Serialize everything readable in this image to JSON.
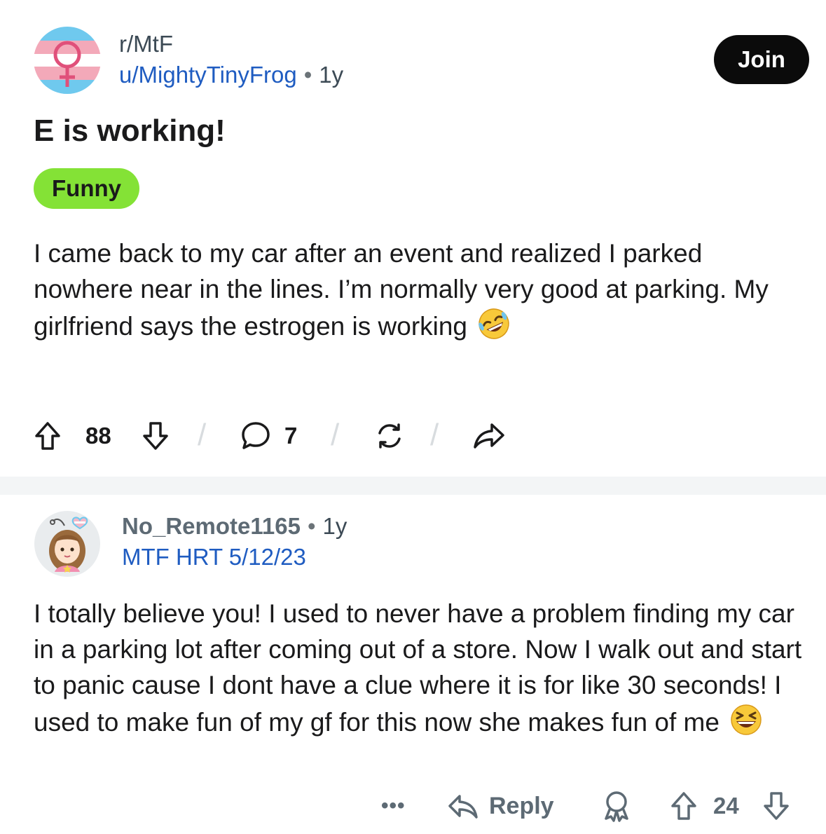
{
  "post": {
    "subreddit": "r/MtF",
    "username": "u/MightyTinyFrog",
    "separator": "•",
    "age": "1y",
    "join_label": "Join",
    "title": "E is working!",
    "flair": "Funny",
    "flair_color": "#84e236",
    "body": "I came back to my car after an event and realized I parked nowhere near in the lines. I’m normally very good at parking. My girlfriend says the estrogen is working",
    "body_emoji": "rolling-on-floor-laughing-emoji",
    "upvotes": "88",
    "comments": "7"
  },
  "comment": {
    "username": "No_Remote1165",
    "separator": "•",
    "age": "1y",
    "flair": "MTF HRT 5/12/23",
    "body": "I totally believe you! I used to never have a problem finding my car in a parking lot after coming out of a store. Now I walk out and start to panic cause I dont have a clue where it is for like 30 seconds! I used to make fun of my gf for this now she makes fun of me",
    "body_emoji": "grinning-squinting-face-emoji",
    "more_label": "•••",
    "reply_label": "Reply",
    "score": "24"
  },
  "colors": {
    "link_blue": "#1f5cc1",
    "join_bg": "#0b0b0b",
    "divider": "#f3f5f6"
  }
}
